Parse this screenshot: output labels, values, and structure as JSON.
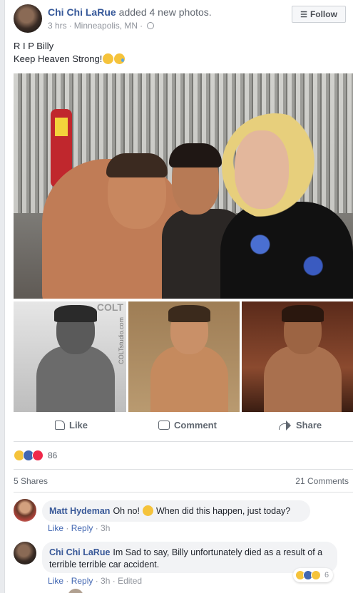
{
  "post": {
    "author": "Chi Chi LaRue",
    "action": "added 4 new photos.",
    "time": "3 hrs",
    "location": "Minneapolis, MN",
    "follow_label": "Follow",
    "text_line1": "R I P Billy",
    "text_line2": "Keep Heaven Strong!",
    "photo_watermark": "COLT",
    "photo_watermark_url": "COLTstudio.com"
  },
  "actions": {
    "like_label": "Like",
    "comment_label": "Comment",
    "share_label": "Share"
  },
  "reactions": {
    "count": "86",
    "types": [
      "sad-icon",
      "like-icon",
      "love-icon"
    ]
  },
  "stats": {
    "shares": "5 Shares",
    "comments": "21 Comments"
  },
  "comments": [
    {
      "author": "Matt Hydeman",
      "text_before": "Oh no!",
      "text_after": "When did this happen, just today?",
      "like": "Like",
      "reply": "Reply",
      "time": "3h"
    },
    {
      "author": "Chi Chi LaRue",
      "text": "Im Sad to say, Billy unfortunately died as a result of a terrible terrible car accident.",
      "like": "Like",
      "reply": "Reply",
      "time": "3h",
      "edited": "Edited",
      "reaction_count": "6"
    }
  ],
  "colors": {
    "link": "#365899",
    "meta": "#90949c",
    "like_blue": "#4267b2",
    "love_red": "#f0284a",
    "sad_yellow": "#f5c33b"
  }
}
